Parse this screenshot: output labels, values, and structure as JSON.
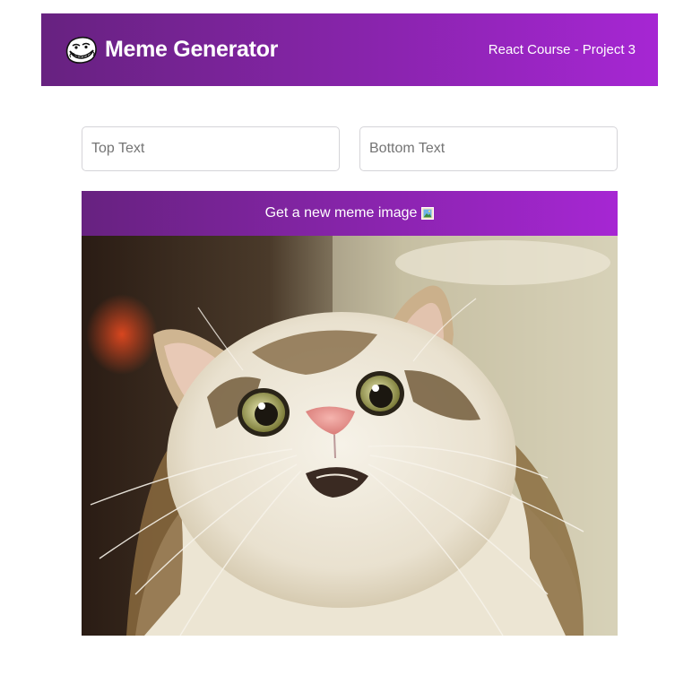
{
  "header": {
    "title": "Meme Generator",
    "subtitle": "React Course - Project 3",
    "logo_icon": "troll-face-icon"
  },
  "form": {
    "top_text": {
      "value": "",
      "placeholder": "Top Text"
    },
    "bottom_text": {
      "value": "",
      "placeholder": "Bottom Text"
    },
    "button_label": "Get a new meme image",
    "button_icon": "framed-picture-icon"
  },
  "meme": {
    "image_subject": "surprised-cat",
    "top_caption": "",
    "bottom_caption": ""
  },
  "colors": {
    "gradient_start": "#672280",
    "gradient_end": "#A626D3",
    "input_border": "#D5D4D8",
    "placeholder": "#747474"
  }
}
